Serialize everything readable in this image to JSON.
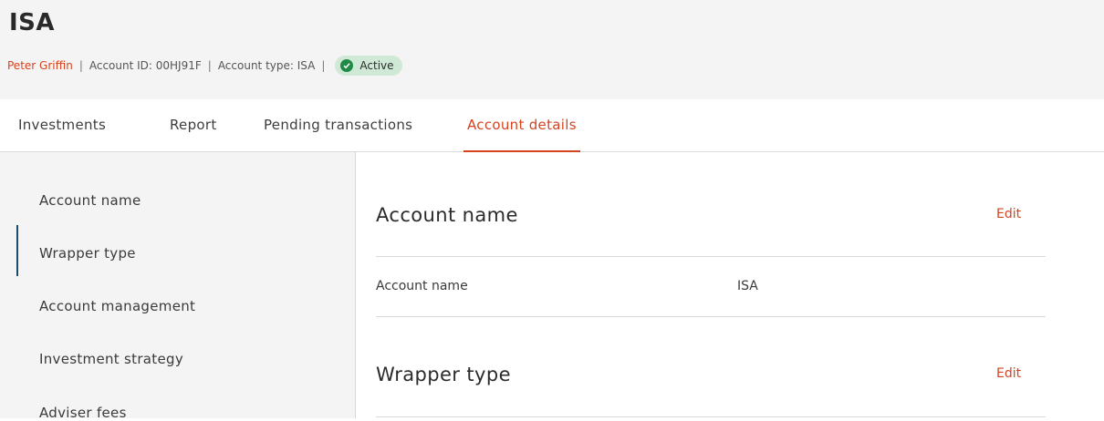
{
  "header": {
    "title": "ISA",
    "owner": "Peter Griffin",
    "separator": "|",
    "account_id": "Account ID: 00HJ91F",
    "account_type": "Account type: ISA",
    "status": "Active",
    "status_color": "#1f8a45"
  },
  "tabs": [
    {
      "label": "Investments",
      "active": false
    },
    {
      "label": "Report",
      "active": false
    },
    {
      "label": "Pending transactions",
      "active": false
    },
    {
      "label": "Account details",
      "active": true
    }
  ],
  "sidebar": {
    "items": [
      {
        "label": "Account name",
        "active": false
      },
      {
        "label": "Wrapper type",
        "active": true
      },
      {
        "label": "Account management",
        "active": false
      },
      {
        "label": "Investment strategy",
        "active": false
      },
      {
        "label": "Adviser fees",
        "active": false
      }
    ]
  },
  "sections": [
    {
      "title": "Account name",
      "edit_label": "Edit",
      "fields": [
        {
          "label": "Account name",
          "value": "ISA"
        }
      ]
    },
    {
      "title": "Wrapper type",
      "edit_label": "Edit"
    }
  ],
  "colors": {
    "accent": "#d5431f",
    "nav_indicator": "#1b4d6b",
    "status_bg": "#cfe9d6"
  }
}
